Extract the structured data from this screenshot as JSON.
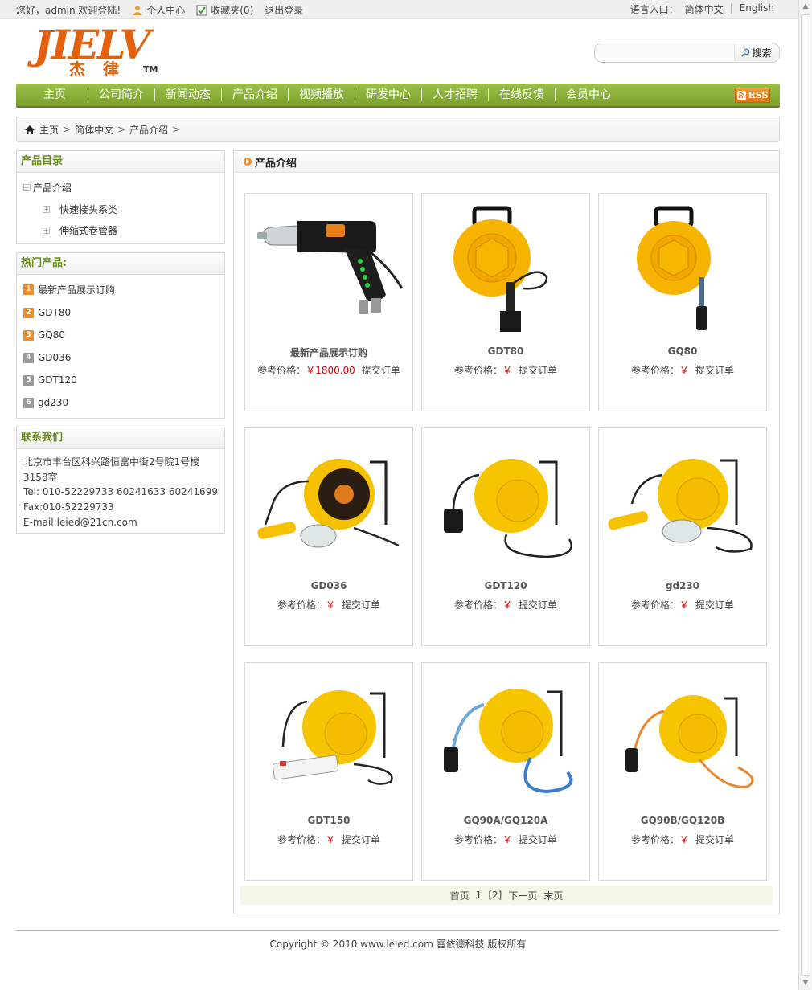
{
  "topbar": {
    "greeting": "您好，admin 欢迎登陆!",
    "user_center": "个人中心",
    "favorites": "收藏夹(0)",
    "logout": "退出登录",
    "language_label": "语言入口：",
    "lang_cn": "简体中文",
    "lang_en": "English"
  },
  "logo": {
    "mark": "JIELV",
    "chinese": "杰律",
    "tm": "TM",
    "color": "#e3610c"
  },
  "search": {
    "value": "",
    "button": "搜索"
  },
  "nav": {
    "items": [
      "主页",
      "公司简介",
      "新闻动态",
      "产品介绍",
      "视频播放",
      "研发中心",
      "人才招聘",
      "在线反馈",
      "会员中心"
    ],
    "rss": "RSS",
    "color": "#86ad36"
  },
  "breadcrumb": {
    "home": "主页",
    "lang": "简体中文",
    "section": "产品介绍"
  },
  "sidebar": {
    "catalog": {
      "title": "产品目录",
      "root": "产品介绍",
      "children": [
        "快速接头系类",
        "伸缩式卷管器"
      ]
    },
    "hot": {
      "title": "热门产品:",
      "items": [
        {
          "rank": "1",
          "label": "最新产品展示订购"
        },
        {
          "rank": "2",
          "label": "GDT80"
        },
        {
          "rank": "3",
          "label": "GQ80"
        },
        {
          "rank": "4",
          "label": "GD036"
        },
        {
          "rank": "5",
          "label": "GDT120"
        },
        {
          "rank": "6",
          "label": "gd230"
        }
      ]
    },
    "contact": {
      "title": "联系我们",
      "address1": "北京市丰台区科兴路恒富中街2号院1号楼",
      "address2": "3158室",
      "tel": "Tel: 010-52229733  60241633  60241699",
      "fax": "Fax:010-52229733",
      "email": "E-mail:leied@21cn.com"
    }
  },
  "main": {
    "title": "产品介绍",
    "price_label": "参考价格：",
    "currency": "￥",
    "order_label": "提交订单",
    "products": [
      {
        "name": "最新产品展示订购",
        "price": "1800.00",
        "image": "spray-gun"
      },
      {
        "name": "GDT80",
        "price": "",
        "image": "reel-plug"
      },
      {
        "name": "GQ80",
        "price": "",
        "image": "reel-hose"
      },
      {
        "name": "GD036",
        "price": "",
        "image": "reel-lamp-black"
      },
      {
        "name": "GDT120",
        "price": "",
        "image": "reel-socket"
      },
      {
        "name": "gd230",
        "price": "",
        "image": "reel-lamp"
      },
      {
        "name": "GDT150",
        "price": "",
        "image": "reel-strip"
      },
      {
        "name": "GQ90A/GQ120A",
        "price": "",
        "image": "reel-blue-hose"
      },
      {
        "name": "GQ90B/GQ120B",
        "price": "",
        "image": "reel-orange-hose"
      }
    ],
    "pager": {
      "first": "首页",
      "p1": "1",
      "p2": "[2]",
      "next": "下一页",
      "last": "末页"
    }
  },
  "footer": {
    "copyright": "Copyright © 2010 www.leied.com 雷依德科技  版权所有"
  }
}
